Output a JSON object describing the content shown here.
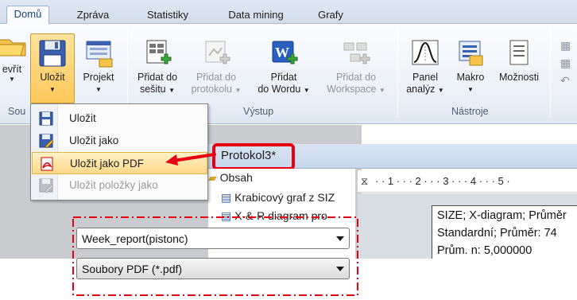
{
  "tabs": [
    "Domů",
    "Zpráva",
    "Statistiky",
    "Data mining",
    "Grafy"
  ],
  "ribbon": {
    "buttons": {
      "otevrit": {
        "label": "evřít"
      },
      "ulozit": {
        "label": "Uložit"
      },
      "projekt": {
        "label": "Projekt"
      },
      "pridat_sesitu": {
        "label1": "Přidat do",
        "label2": "sešitu"
      },
      "pridat_protokolu": {
        "label1": "Přidat do",
        "label2": "protokolu"
      },
      "pridat_wordu": {
        "label1": "Přidat",
        "label2": "do Wordu"
      },
      "pridat_workspace": {
        "label1": "Přidat do",
        "label2": "Workspace"
      },
      "panel": {
        "label1": "Panel",
        "label2": "analýz"
      },
      "makro": {
        "label": "Makro"
      },
      "moznosti": {
        "label": "Možnosti"
      }
    },
    "groups": {
      "soubor": "Sou",
      "vystup": "Výstup",
      "nastroje": "Nástroje"
    }
  },
  "menu": {
    "items": [
      {
        "label": "Uložit",
        "icon": "floppy-icon",
        "state": "normal"
      },
      {
        "label": "Uložit jako",
        "icon": "save-as-icon",
        "state": "normal"
      },
      {
        "label": "Uložit jako PDF",
        "icon": "pdf-icon",
        "state": "highlighted"
      },
      {
        "label": "Uložit položky jako",
        "icon": "save-items-icon",
        "state": "disabled"
      }
    ]
  },
  "window": {
    "title": "Protokol3*"
  },
  "tree": {
    "root": "Obsah",
    "items": [
      "Krabicový graf z SIZ",
      "X-&-R diagram pro"
    ]
  },
  "ruler": {
    "text": "· · 1 · · · 2 · · · 3 · · · 4 · · · 5 ·"
  },
  "document": {
    "lines": [
      "SIZE; X-diagram; Průměr",
      "Standardní; Průměr: 74",
      "Prům. n: 5,000000"
    ]
  },
  "save_dialog": {
    "filename": "Week_report(pistonc)",
    "filetype": "Soubory PDF (*.pdf)"
  },
  "colors": {
    "accent": "#e60012",
    "highlight": "#ffd98a",
    "ribbon_text": "#1e1e1e"
  }
}
